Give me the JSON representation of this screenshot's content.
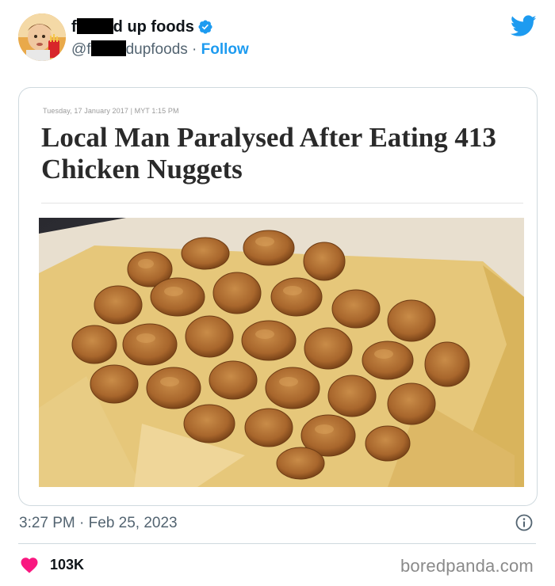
{
  "author": {
    "name_prefix": "f",
    "name_suffix": "d up foods",
    "handle_prefix": "@f",
    "handle_suffix": "dupfoods",
    "separator": "·",
    "follow_label": "Follow",
    "verified_color": "#1d9bf0"
  },
  "post_image": {
    "dateline": "Tuesday, 17 January 2017 | MYT 1:15 PM",
    "headline": "Local Man Paralysed After Eating 413 Chicken Nuggets"
  },
  "meta": {
    "timestamp": "3:27 PM · Feb 25, 2023"
  },
  "engagement": {
    "likes": "103K"
  },
  "watermark": "boredpanda.com",
  "icons": [
    "verified-badge-icon",
    "twitter-bird-icon",
    "info-icon",
    "heart-icon"
  ],
  "colors": {
    "accent": "#1d9bf0",
    "heart": "#f91880",
    "text": "#0f1419",
    "muted": "#536471"
  }
}
